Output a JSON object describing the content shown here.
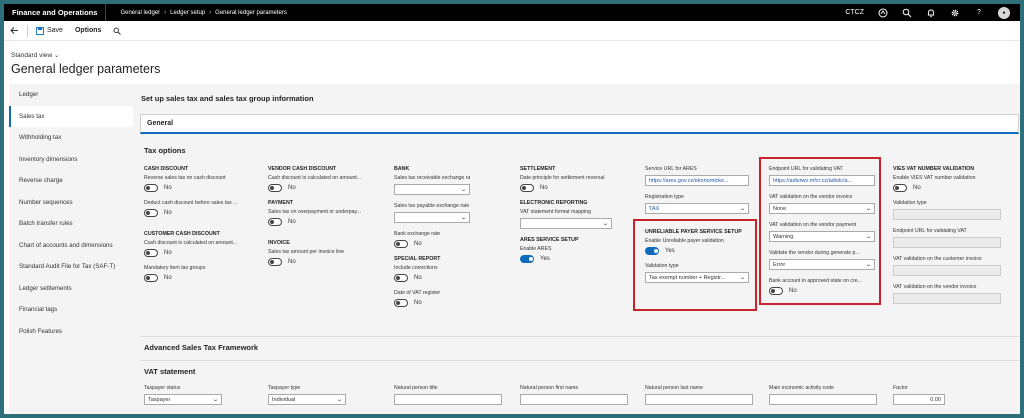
{
  "topbar": {
    "app_title": "Finance and Operations",
    "crumbs": [
      "General ledger",
      "Ledger setup",
      "General ledger parameters"
    ],
    "company": "CTCZ"
  },
  "actionbar": {
    "save_label": "Save",
    "options_label": "Options"
  },
  "view_selector": "Standard view",
  "page_title": "General ledger parameters",
  "nav_items": [
    "Ledger",
    "Sales tax",
    "Withholding tax",
    "Inventory dimensions",
    "Reverse charge",
    "Number sequences",
    "Batch transfer rules",
    "Chart of accounts and dimensions",
    "Standard Audit File for Tax (SAF-T)",
    "Ledger settlements",
    "Financial tags",
    "Polish Features"
  ],
  "intro": "Set up sales tax and sales tax group information",
  "general_tab": "General",
  "tax_options": {
    "title": "Tax options",
    "cash_discount": {
      "header": "CASH DISCOUNT",
      "reverse_label": "Reverse sales tax on cash discount",
      "reverse_value": "No",
      "deduct_label": "Deduct cash discount before sales tax ...",
      "deduct_value": "No"
    },
    "customer_cash_discount": {
      "header": "CUSTOMER CASH DISCOUNT",
      "calc_label": "Cash discount is calculated on amount...",
      "calc_value": "No",
      "mandatory_label": "Mandatory item tax groups",
      "mandatory_value": "No"
    },
    "vendor_cash_discount": {
      "header": "VENDOR CASH DISCOUNT",
      "calc_label": "Cash discount is calculated on amount...",
      "calc_value": "No"
    },
    "payment": {
      "header": "PAYMENT",
      "over_label": "Sales tax on overpayment or underpay...",
      "over_value": "No"
    },
    "invoice": {
      "header": "INVOICE",
      "per_line_label": "Sales tax amount per invoice line",
      "per_line_value": "No"
    },
    "bank": {
      "header": "BANK",
      "receivable_label": "Sales tax receivable exchange rate type",
      "payable_label": "Sales tax payable exchange rate type",
      "bank_rate_label": "Bank exchange rate",
      "bank_rate_value": "No"
    },
    "special_report": {
      "header": "SPECIAL REPORT",
      "corrections_label": "Include corrections",
      "corrections_value": "No",
      "vat_register_label": "Date of VAT register",
      "vat_register_value": "No"
    },
    "settlement": {
      "header": "SETTLEMENT",
      "date_principle_label": "Date principle for settlement reversal",
      "date_principle_value": "No"
    },
    "electronic_reporting": {
      "header": "ELECTRONIC REPORTING",
      "vat_format_label": "VAT statement format mapping"
    },
    "ares": {
      "header": "ARES SERVICE SETUP",
      "enable_label": "Enable ARES",
      "enable_value": "Yes",
      "url_label": "Service URL for ARES",
      "url_value": "https://ares.gov.cz/ekonomicke...",
      "reg_type_label": "Registration type",
      "reg_type_value": "TAX"
    },
    "unreliable": {
      "header": "UNRELIABLE PAYER SERVICE SETUP",
      "enable_label": "Enable Unreliable payer validation",
      "enable_value": "Yes",
      "validation_type_label": "Validation type",
      "validation_type_value": "Tax exempt number + Registr..."
    },
    "vat_endpoint": {
      "endpoint_label": "Endpoint URL for validating VAT",
      "endpoint_value": "https://adisrws.mfcr.cz/adistc/a...",
      "vendor_invoice_label": "VAT validation on the vendor invoice",
      "vendor_invoice_value": "None",
      "vendor_payment_label": "VAT validation on the vendor payment",
      "vendor_payment_value": "Warning",
      "generate_label": "Validate the vendor during generate p...",
      "generate_value": "Error",
      "bank_account_label": "Bank account in approved state on cre...",
      "bank_account_value": "No"
    },
    "vies": {
      "header": "VIES VAT NUMBER VALIDATION",
      "enable_label": "Enable VIES VAT number validation",
      "enable_value": "No",
      "validation_type_label": "Validation type",
      "endpoint_label": "Endpoint URL for validating VAT",
      "customer_invoice_label": "VAT validation on the customer invoice",
      "vendor_invoice_label": "VAT validation on the vendor invoice"
    }
  },
  "advanced_title": "Advanced Sales Tax Framework",
  "vat_statement": {
    "title": "VAT statement",
    "taxpayer_status_label": "Taxpayer status",
    "taxpayer_status_value": "Taxpayer",
    "taxpayer_type_label": "Taxpayer type",
    "taxpayer_type_value": "Individual",
    "person_title_label": "Natural person title",
    "person_first_label": "Natural person first name",
    "person_last_label": "Natural person last name",
    "main_activity_label": "Main economic activity code",
    "factor_label": "Factor",
    "factor_value": "0.00"
  }
}
